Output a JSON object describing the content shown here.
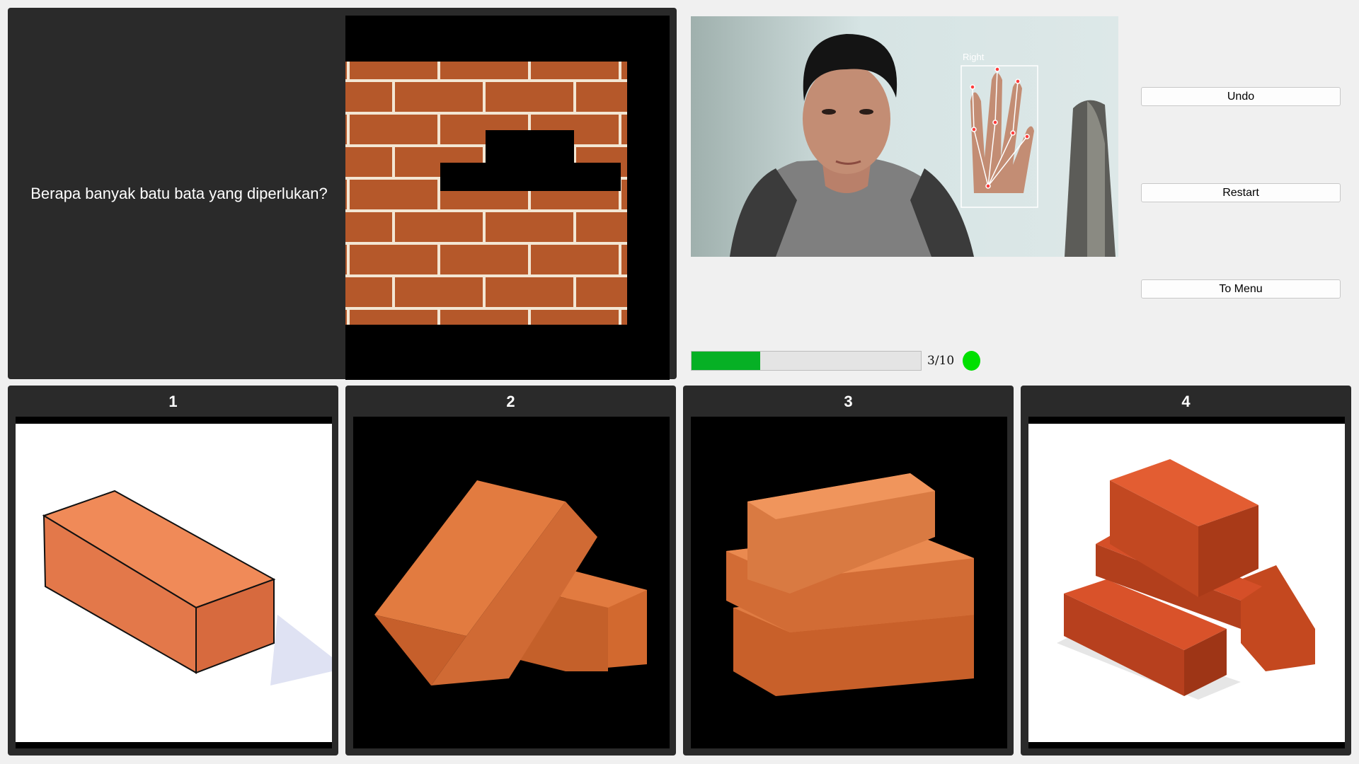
{
  "question": {
    "text": "Berapa banyak batu bata yang diperlukan?"
  },
  "camera": {
    "hand_label": "Right"
  },
  "buttons": {
    "undo": "Undo",
    "restart": "Restart",
    "menu": "To Menu"
  },
  "progress": {
    "label": "3/10",
    "fraction": 0.3,
    "status_color": "#00e000"
  },
  "choices": [
    {
      "label": "1",
      "image": "single-brick-illustration"
    },
    {
      "label": "2",
      "image": "two-bricks"
    },
    {
      "label": "3",
      "image": "three-stacked-bricks"
    },
    {
      "label": "4",
      "image": "four-bricks-pile"
    }
  ],
  "colors": {
    "panel": "#2a2a2a",
    "brick": "#b5582a",
    "mortar": "#f3e6d3",
    "progress": "#06b025"
  }
}
